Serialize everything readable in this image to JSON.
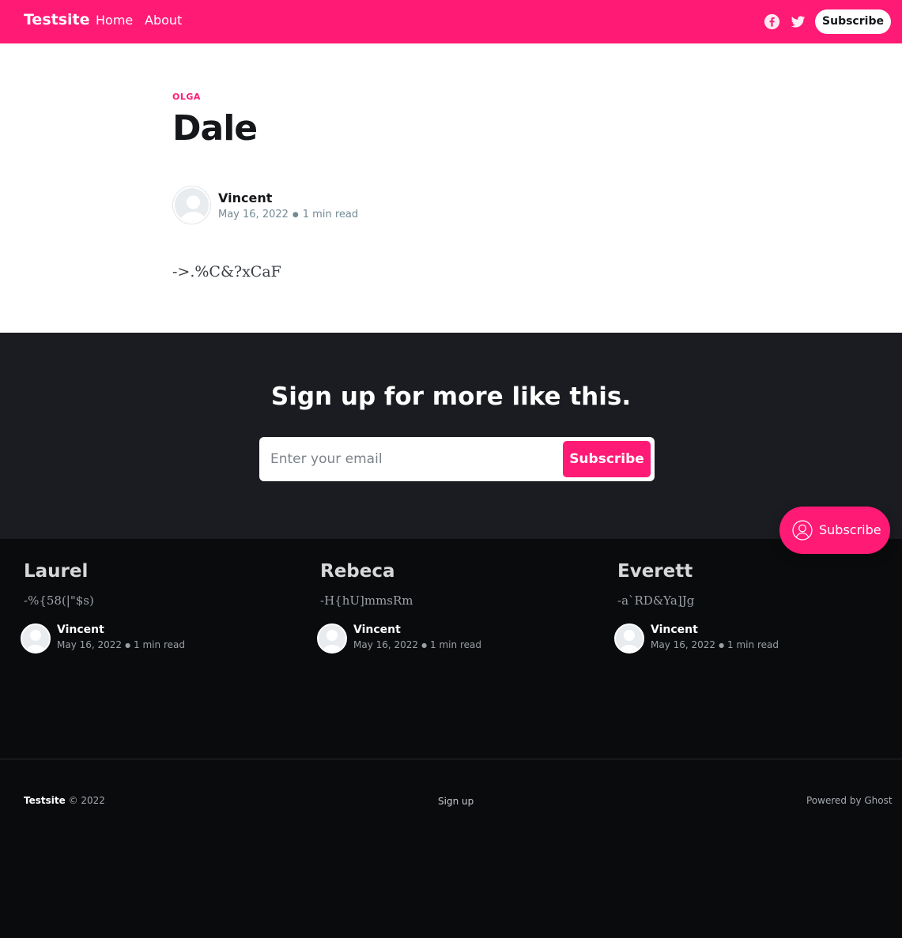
{
  "header": {
    "brand": "Testsite",
    "nav": {
      "home": "Home",
      "about": "About"
    },
    "social_icons": [
      "facebook-icon",
      "twitter-icon"
    ],
    "subscribe_label": "Subscribe"
  },
  "article": {
    "tag": "OLGA",
    "title": "Dale",
    "author": "Vincent",
    "date": "May 16, 2022",
    "reading_time": "1 min read",
    "body": "->.%C&?xCaF"
  },
  "cta": {
    "title": "Sign up for more like this.",
    "email_placeholder": "Enter your email",
    "button_label": "Subscribe"
  },
  "portal": {
    "label": "Subscribe",
    "icon": "user-circle-icon"
  },
  "related": [
    {
      "title": "Laurel",
      "excerpt": "-%{58(|\"$s)",
      "author": "Vincent",
      "date": "May 16, 2022",
      "reading_time": "1 min read"
    },
    {
      "title": "Rebeca",
      "excerpt": "-H{hU]mmsRm",
      "author": "Vincent",
      "date": "May 16, 2022",
      "reading_time": "1 min read"
    },
    {
      "title": "Everett",
      "excerpt": "-a`RD&Ya]Jg",
      "author": "Vincent",
      "date": "May 16, 2022",
      "reading_time": "1 min read"
    }
  ],
  "footer": {
    "brand": "Testsite",
    "year_text": "© 2022",
    "signup_label": "Sign up",
    "powered_by": "Powered by Ghost"
  },
  "colors": {
    "accent": "#ff1a75",
    "cta_background": "#1a1c21",
    "footer_background": "#0a0b0d"
  }
}
